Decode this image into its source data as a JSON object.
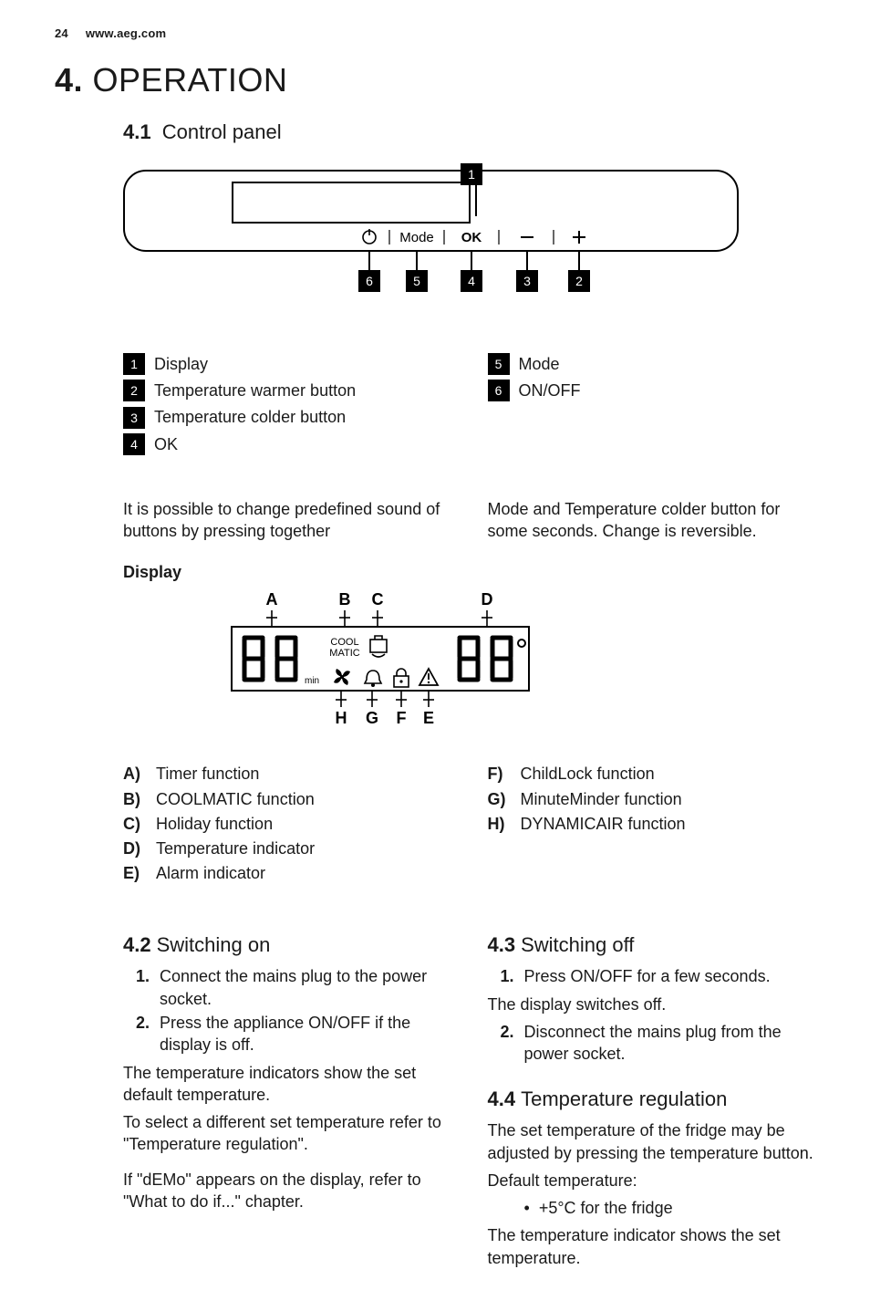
{
  "header": {
    "page": "24",
    "site": "www.aeg.com"
  },
  "chapter": {
    "number": "4.",
    "title": "OPERATION"
  },
  "s41": {
    "number": "4.1",
    "title": "Control panel"
  },
  "panelButtons": {
    "mode": "Mode",
    "ok": "OK"
  },
  "panelCallouts": [
    "1",
    "2",
    "3",
    "4",
    "5",
    "6"
  ],
  "panelLegendLeft": [
    {
      "n": "1",
      "t": "Display"
    },
    {
      "n": "2",
      "t": "Temperature warmer button"
    },
    {
      "n": "3",
      "t": "Temperature colder button"
    },
    {
      "n": "4",
      "t": "OK"
    }
  ],
  "panelLegendRight": [
    {
      "n": "5",
      "t": "Mode"
    },
    {
      "n": "6",
      "t": "ON/OFF"
    }
  ],
  "soundNote": {
    "left": "It is possible to change predefined sound of buttons by pressing together",
    "right": "Mode and Temperature colder button for some seconds. Change is reversible."
  },
  "displayHeading": "Display",
  "displayLabelsTop": [
    "A",
    "B",
    "C",
    "D"
  ],
  "displayLabelsBottom": [
    "H",
    "G",
    "F",
    "E"
  ],
  "displayText": {
    "cool": "COOL",
    "matic": "MATIC",
    "min": "min"
  },
  "displayLegendLeft": [
    {
      "l": "A)",
      "t": "Timer function"
    },
    {
      "l": "B)",
      "t": "COOLMATIC function"
    },
    {
      "l": "C)",
      "t": "Holiday function"
    },
    {
      "l": "D)",
      "t": "Temperature indicator"
    },
    {
      "l": "E)",
      "t": "Alarm indicator"
    }
  ],
  "displayLegendRight": [
    {
      "l": "F)",
      "t": "ChildLock function"
    },
    {
      "l": "G)",
      "t": "MinuteMinder function"
    },
    {
      "l": "H)",
      "t": "DYNAMICAIR function"
    }
  ],
  "s42": {
    "number": "4.2",
    "title": "Switching on",
    "steps": [
      "Connect the mains plug to the power socket.",
      "Press the appliance ON/OFF if the display is off."
    ],
    "para1": "The temperature indicators show the set default temperature.",
    "para2": "To select a different set temperature refer to \"Temperature regulation\".",
    "para3": "If \"dEMo\" appears on the display, refer to \"What to do if...\" chapter."
  },
  "s43": {
    "number": "4.3",
    "title": "Switching off",
    "step1": "Press ON/OFF for a few seconds.",
    "mid": "The display switches off.",
    "step2": "Disconnect the mains plug from the power socket."
  },
  "s44": {
    "number": "4.4",
    "title": "Temperature regulation",
    "para1": "The set temperature of the fridge may be adjusted by pressing the temperature button.",
    "para2": "Default temperature:",
    "bullet": "+5°C for the fridge",
    "para3": "The temperature indicator shows the set temperature."
  }
}
